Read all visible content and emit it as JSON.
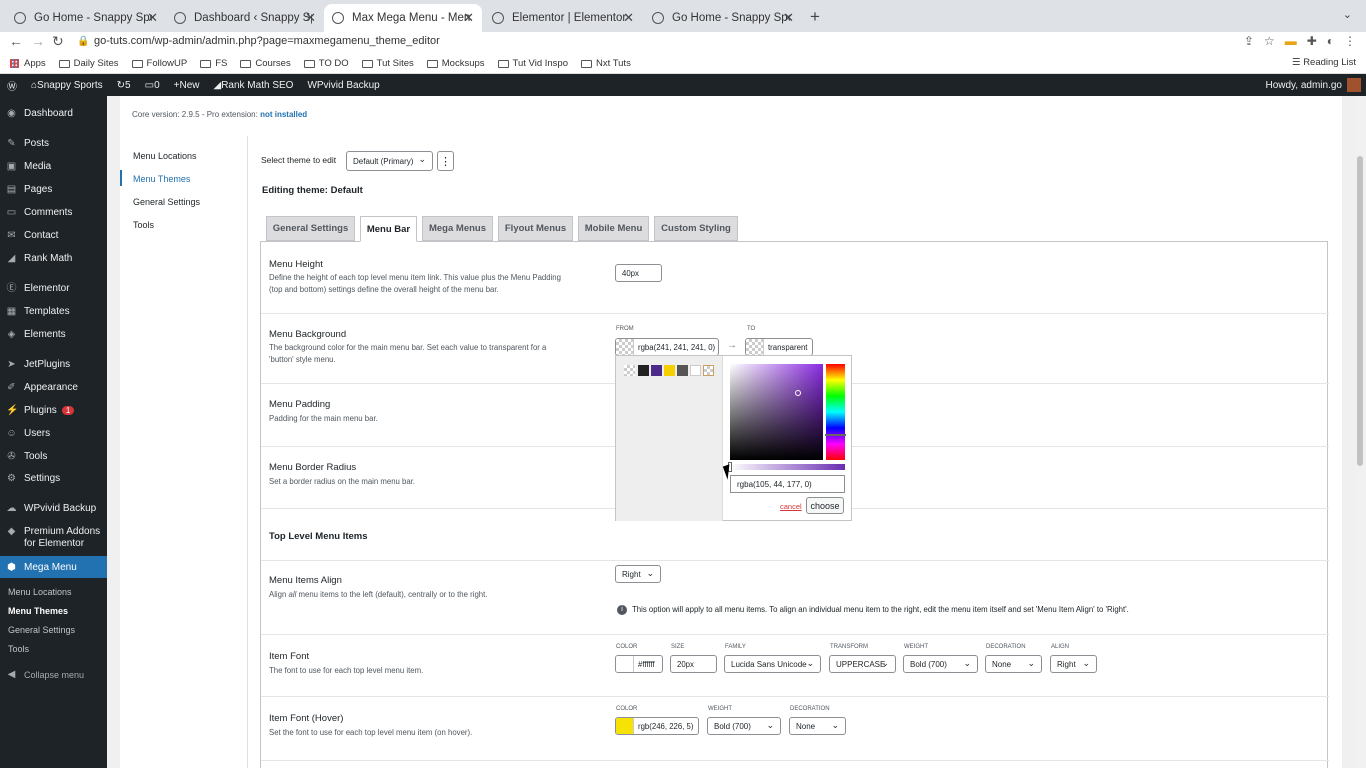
{
  "browser": {
    "tabs": [
      {
        "title": "Go Home - Snappy Sports",
        "active": false
      },
      {
        "title": "Dashboard ‹ Snappy Sports —",
        "active": false
      },
      {
        "title": "Max Mega Menu - Menu Them",
        "active": true
      },
      {
        "title": "Elementor | Elementor Header",
        "active": false
      },
      {
        "title": "Go Home - Snappy Sports",
        "active": false
      }
    ],
    "url": "go-tuts.com/wp-admin/admin.php?page=maxmegamenu_theme_editor",
    "bookmarks": [
      "Apps",
      "Daily Sites",
      "FollowUP",
      "FS",
      "Courses",
      "TO DO",
      "Tut Sites",
      "Mocksups",
      "Tut Vid Inspo",
      "Nxt Tuts"
    ],
    "reading_list": "Reading List"
  },
  "adminbar": {
    "site": "Snappy Sports",
    "updates": "5",
    "comments": "0",
    "new": "New",
    "rankmath": "Rank Math SEO",
    "wpvivid": "WPvivid Backup",
    "howdy": "Howdy, admin.go"
  },
  "sidebar": {
    "items": [
      "Dashboard",
      "Posts",
      "Media",
      "Pages",
      "Comments",
      "Contact",
      "Rank Math",
      "Elementor",
      "Templates",
      "Elements",
      "JetPlugins",
      "Appearance",
      "Plugins",
      "Users",
      "Tools",
      "Settings",
      "WPvivid Backup",
      "Premium Addons",
      "for Elementor",
      "Mega Menu"
    ],
    "plugins_badge": "1",
    "sub": [
      "Menu Locations",
      "Menu Themes",
      "General Settings",
      "Tools"
    ],
    "collapse": "Collapse menu"
  },
  "page": {
    "core_version": "Core version: 2.9.5 - Pro extension:",
    "not_installed": "not installed",
    "submenu": [
      "Menu Locations",
      "Menu Themes",
      "General Settings",
      "Tools"
    ],
    "select_theme_label": "Select theme to edit",
    "select_theme_value": "Default (Primary)",
    "editing_theme": "Editing theme: Default",
    "tabs": [
      "General Settings",
      "Menu Bar",
      "Mega Menus",
      "Flyout Menus",
      "Mobile Menu",
      "Custom Styling"
    ],
    "rows": {
      "menu_height": {
        "title": "Menu Height",
        "desc1": "Define the height of each top level menu item link. This value plus the Menu Padding",
        "desc2": "(top and bottom) settings define the overall height of the menu bar.",
        "value": "40px"
      },
      "menu_background": {
        "title": "Menu Background",
        "desc1": "The background color for the main menu bar. Set each value to transparent for a",
        "desc2": "'button' style menu.",
        "from_label": "FROM",
        "from_value": "rgba(241, 241, 241, 0)",
        "to_label": "TO",
        "to_value": "transparent"
      },
      "menu_padding": {
        "title": "Menu Padding",
        "desc": "Padding for the main menu bar."
      },
      "menu_border_radius": {
        "title": "Menu Border Radius",
        "desc": "Set a border radius on the main menu bar."
      },
      "top_level": {
        "title": "Top Level Menu Items"
      },
      "items_align": {
        "title": "Menu Items Align",
        "desc_pre": "Align",
        "desc_all": "all",
        "desc_post": "menu items to the left (default), centrally or to the right.",
        "value": "Right",
        "note": "This option will apply to all menu items. To align an individual menu item to the right, edit the menu item itself and set 'Menu Item Align' to 'Right'."
      },
      "item_font": {
        "title": "Item Font",
        "desc": "The font to use for each top level menu item.",
        "labels": [
          "COLOR",
          "SIZE",
          "FAMILY",
          "TRANSFORM",
          "WEIGHT",
          "DECORATION",
          "ALIGN"
        ],
        "color": "#ffffff",
        "size": "20px",
        "family": "Lucida Sans Unicode",
        "transform": "UPPERCASE",
        "weight": "Bold (700)",
        "decoration": "None",
        "align": "Right"
      },
      "item_font_hover": {
        "title": "Item Font (Hover)",
        "desc": "Set the font to use for each top level menu item (on hover).",
        "labels": [
          "COLOR",
          "WEIGHT",
          "DECORATION"
        ],
        "color": "rgb(246, 226, 5)",
        "weight": "Bold (700)",
        "decoration": "None"
      }
    },
    "picker": {
      "value": "rgba(105, 44, 177, 0)",
      "cancel": "cancel",
      "choose": "choose"
    }
  },
  "colors": {
    "accent": "#2271b1",
    "admin_bg": "#1d2327",
    "hover_swatch": "#f6e205",
    "swatches": [
      "checker",
      "#222222",
      "#4b2a8a",
      "#f5d000",
      "#555555",
      "#ffffff",
      "checker"
    ]
  }
}
